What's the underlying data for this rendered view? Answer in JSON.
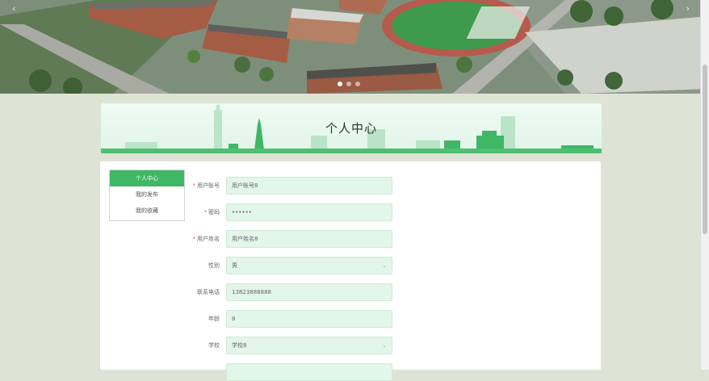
{
  "hero": {
    "prev_label": "‹",
    "next_label": "›",
    "slides": 3,
    "active_slide": 1
  },
  "banner": {
    "title": "个人中心"
  },
  "menu": {
    "items": [
      {
        "label": "个人中心",
        "active": true
      },
      {
        "label": "我的发布",
        "active": false
      },
      {
        "label": "我的收藏",
        "active": false
      }
    ]
  },
  "form": {
    "account": {
      "label": "用户账号",
      "required": "*",
      "value": "用户账号8"
    },
    "password": {
      "label": "密码",
      "required": "*",
      "value": "••••••"
    },
    "name": {
      "label": "用户姓名",
      "required": "*",
      "value": "用户姓名8"
    },
    "gender": {
      "label": "性别",
      "value": "男"
    },
    "phone": {
      "label": "联系电话",
      "value": "13823888888"
    },
    "age": {
      "label": "年龄",
      "value": "8"
    },
    "school": {
      "label": "学校",
      "value": "学校8"
    }
  },
  "colors": {
    "accent": "#3fb765",
    "field_bg": "#e3f6ea",
    "page_bg": "#dfe3d6",
    "required": "#e05b5b"
  },
  "icons": {
    "prev": "chevron-left-icon",
    "next": "chevron-right-icon",
    "select": "chevron-down-icon"
  }
}
